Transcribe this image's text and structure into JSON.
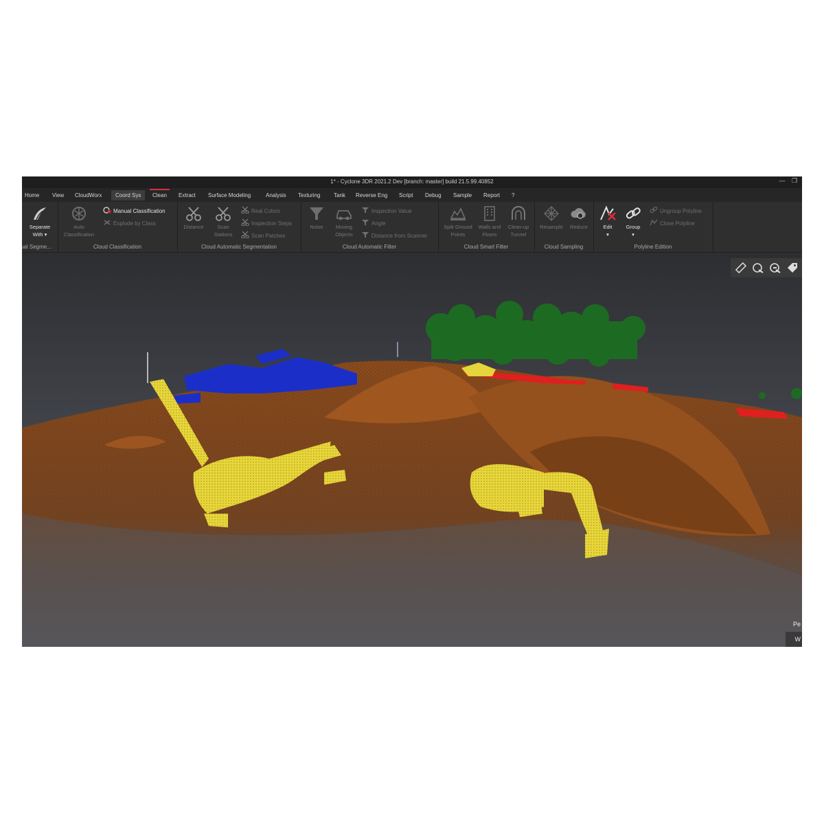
{
  "window": {
    "title": "1* - Cyclone 3DR 2021.2 Dev [branch: master] build 21.5.99.40852",
    "controls": [
      "minimize-icon",
      "restore-icon"
    ]
  },
  "menu": {
    "tabs": [
      {
        "label": "Home"
      },
      {
        "label": "View"
      },
      {
        "label": "CloudWorx"
      },
      {
        "label": "Coord Sys"
      },
      {
        "label": "Clean"
      },
      {
        "label": "Extract"
      },
      {
        "label": "Surface Modeling"
      },
      {
        "label": "Analysis"
      },
      {
        "label": "Texturing"
      },
      {
        "label": "Tank"
      },
      {
        "label": "Reverse Eng"
      },
      {
        "label": "Script"
      },
      {
        "label": "Debug"
      },
      {
        "label": "Sample"
      },
      {
        "label": "Report"
      },
      {
        "label": "?"
      }
    ],
    "selected": "Coord Sys",
    "active": "Clean",
    "accent_color": "#d92f3e"
  },
  "ribbon": {
    "groups": [
      {
        "label": "ual Segme...",
        "buttons": [
          {
            "label1": "Separate",
            "label2": "With",
            "icon": "separate-icon"
          }
        ]
      },
      {
        "label": "Cloud Classification",
        "buttons": [
          {
            "label1": "Auto",
            "label2": "Classification",
            "icon": "auto-classification-icon"
          },
          {
            "label": "Manual Classification",
            "icon": "manual-classification-icon"
          },
          {
            "label": "Explode by Class",
            "icon": "explode-icon"
          }
        ]
      },
      {
        "label": "Cloud Automatic Segmentation",
        "buttons": [
          {
            "label1": "Distance",
            "label2": "",
            "icon": "scissors-icon"
          },
          {
            "label1": "Scan",
            "label2": "Stations",
            "icon": "scissors-icon"
          },
          {
            "label": "Real Colors",
            "icon": "scissors-small-icon"
          },
          {
            "label": "Inspection Steps",
            "icon": "scissors-small-icon"
          },
          {
            "label": "Scan Patches",
            "icon": "scissors-small-icon"
          }
        ]
      },
      {
        "label": "Cloud Automatic Filter",
        "buttons": [
          {
            "label1": "Noise",
            "label2": "",
            "icon": "funnel-icon"
          },
          {
            "label1": "Moving",
            "label2": "Objects",
            "icon": "car-icon"
          },
          {
            "label": "Inspection Value",
            "icon": "filter-small-icon"
          },
          {
            "label": "Angle",
            "icon": "filter-small-icon"
          },
          {
            "label": "Distance from Scanner",
            "icon": "filter-small-icon"
          }
        ]
      },
      {
        "label": "Cloud Smart Filter",
        "buttons": [
          {
            "label1": "Split Ground",
            "label2": "Points",
            "icon": "ground-icon"
          },
          {
            "label1": "Walls and",
            "label2": "Floors",
            "icon": "building-icon"
          },
          {
            "label1": "Clean-up",
            "label2": "Tunnel",
            "icon": "tunnel-icon"
          }
        ]
      },
      {
        "label": "Cloud Sampling",
        "buttons": [
          {
            "label1": "Resample",
            "label2": "",
            "icon": "resample-icon"
          },
          {
            "label1": "Reduce",
            "label2": "",
            "icon": "reduce-icon"
          }
        ]
      },
      {
        "label": "Polyline Edition",
        "buttons": [
          {
            "label1": "Edit",
            "label2": "",
            "icon": "polyline-edit-icon"
          },
          {
            "label1": "Group",
            "label2": "",
            "icon": "chain-link-icon"
          },
          {
            "label": "Ungroup Polyline",
            "icon": "unlink-icon"
          },
          {
            "label": "Close Polyline",
            "icon": "close-polyline-icon"
          }
        ]
      }
    ]
  },
  "viewport": {
    "toolbar_icons": [
      "ruler-icon",
      "pick-icon",
      "pick-alt-icon",
      "tag-icon"
    ],
    "corner_text_1": "Pe",
    "corner_text_2": "W",
    "colors": {
      "ground": "#8a4a1c",
      "vehicles": "#e5d53a",
      "buildings": "#1b2fc8",
      "vegetation": "#1d6b22",
      "barrier": "#e01f1f"
    }
  }
}
